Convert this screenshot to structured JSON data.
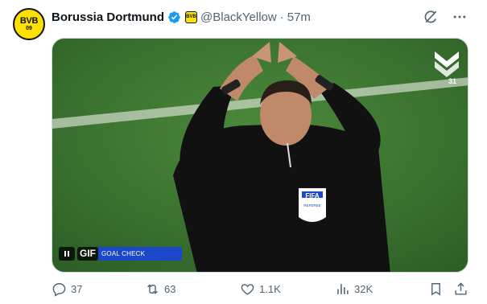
{
  "author": {
    "avatar_text": "BVB",
    "avatar_subtext": "09",
    "name": "Borussia Dortmund",
    "verified": true,
    "affiliate_badge_text": "BVB",
    "handle": "@BlackYellow",
    "separator": "·",
    "time": "57m"
  },
  "header_icons": [
    "grok-icon",
    "more-icon"
  ],
  "media": {
    "type": "gif",
    "gif_label": "GIF",
    "caption_bar": "GOAL CHECK",
    "broadcaster_number": "31",
    "referee_badge": "FIFA",
    "referee_badge_sub": "REFEREE"
  },
  "actions": {
    "replies": "37",
    "reposts": "63",
    "likes": "1.1K",
    "views": "32K"
  },
  "colors": {
    "accent": "#1d9bf0",
    "brand_yellow": "#fde100",
    "muted": "#536471",
    "goal_bar": "#1b47c9"
  }
}
